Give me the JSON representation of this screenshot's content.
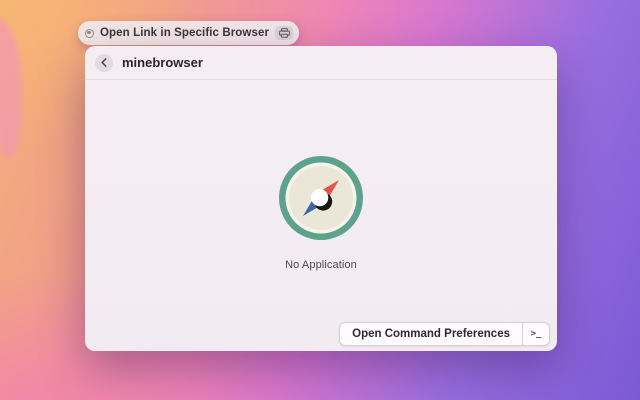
{
  "pill": {
    "label": "Open Link in Specific Browser",
    "left_icon": "ring-icon",
    "right_icon": "printer-icon"
  },
  "panel": {
    "header": {
      "back_icon": "chevron-left-icon",
      "title": "minebrowser"
    },
    "empty_state": {
      "icon": "compass-icon",
      "message": "No Application"
    },
    "footer": {
      "preferences_button_label": "Open Command Preferences",
      "terminal_hint": ">_"
    }
  },
  "colors": {
    "compass_ring": "#5ca28c",
    "compass_face": "#eae7d9",
    "needle_north": "#e2554a",
    "needle_south": "#3d66a4",
    "panel_bg": "#f3ecf3",
    "wallpaper_gradient": [
      "#f5b077",
      "#ee86b4",
      "#9a6ee0",
      "#7b5ad5"
    ]
  }
}
